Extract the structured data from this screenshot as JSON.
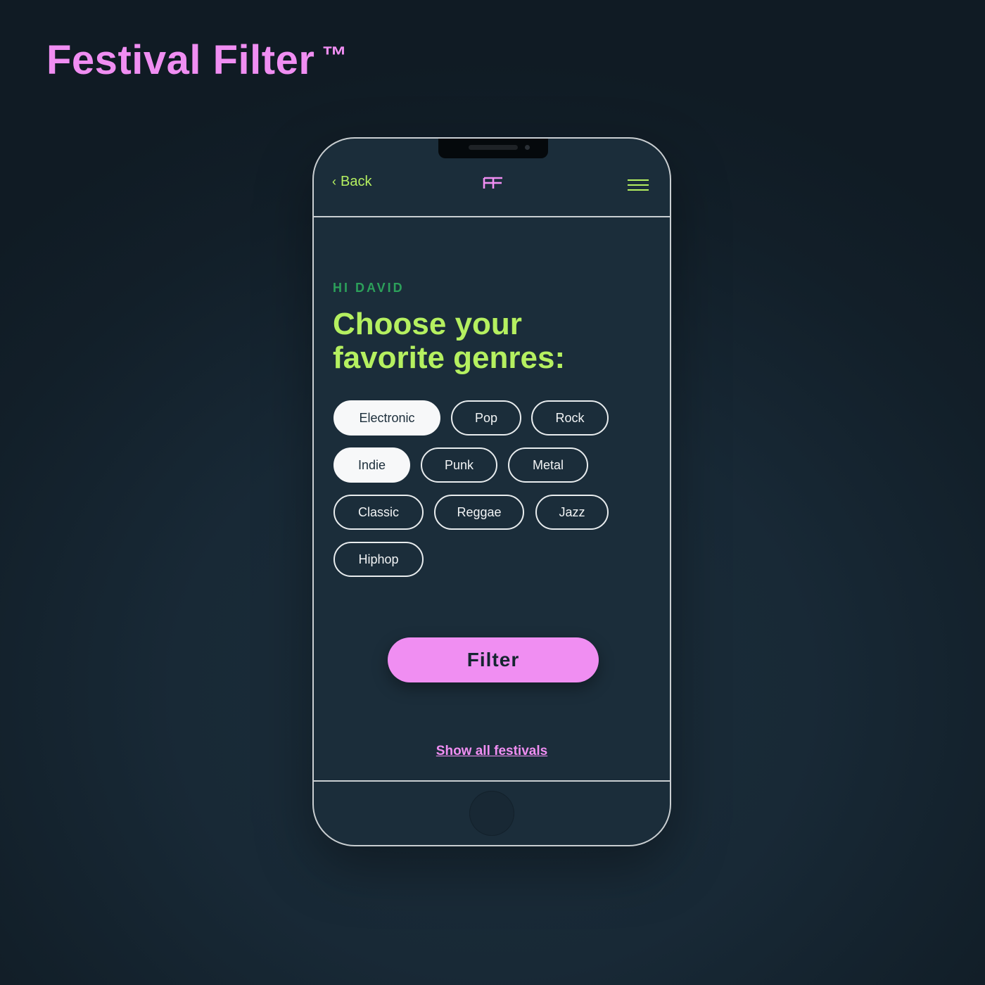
{
  "brand": {
    "name": "Festival Filter",
    "trademark": "™"
  },
  "header": {
    "back_label": "Back",
    "logo_text": "FF"
  },
  "main": {
    "greeting": "HI DAVID",
    "headline": "Choose your favorite genres:",
    "genres": [
      {
        "label": "Electronic",
        "selected": true
      },
      {
        "label": "Pop",
        "selected": false
      },
      {
        "label": "Rock",
        "selected": false
      },
      {
        "label": "Indie",
        "selected": true
      },
      {
        "label": "Punk",
        "selected": false
      },
      {
        "label": "Metal",
        "selected": false
      },
      {
        "label": "Classic",
        "selected": false
      },
      {
        "label": "Reggae",
        "selected": false
      },
      {
        "label": "Jazz",
        "selected": false
      },
      {
        "label": "Hiphop",
        "selected": false
      }
    ],
    "filter_label": "Filter",
    "show_all_label": "Show all festivals"
  },
  "colors": {
    "accent_pink": "#f08ef2",
    "accent_lime": "#b5f060",
    "greeting_green": "#2ca05a",
    "background": "#1b2d3a"
  }
}
